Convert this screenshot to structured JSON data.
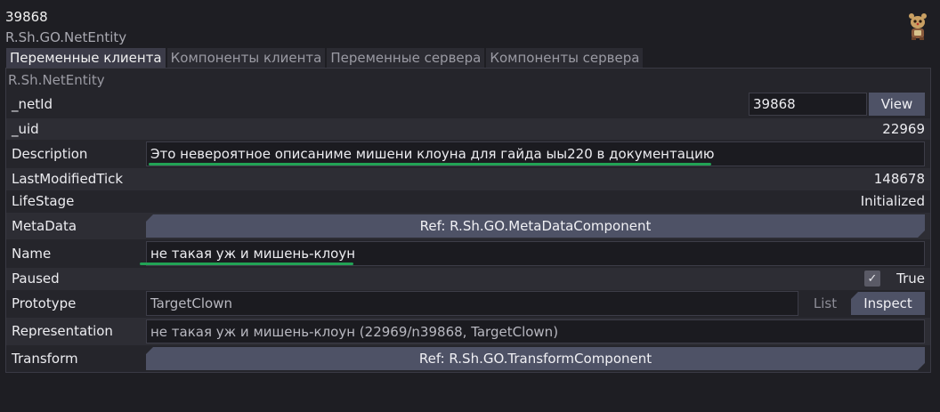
{
  "header": {
    "entity_id": "39868",
    "entity_type": "R.Sh.GO.NetEntity",
    "mascot_icon": "clown-mascot-icon"
  },
  "tabs": [
    {
      "label": "Переменные клиента",
      "active": true
    },
    {
      "label": "Компоненты клиента",
      "active": false
    },
    {
      "label": "Переменные сервера",
      "active": false
    },
    {
      "label": "Компоненты сервера",
      "active": false
    }
  ],
  "panel": {
    "subheader": "R.Sh.NetEntity",
    "rows": {
      "net_id": {
        "label": "_netId",
        "value": "39868",
        "button": "View"
      },
      "uid": {
        "label": "_uid",
        "value": "22969"
      },
      "description": {
        "label": "Description",
        "value": "Это невероятное описаниме мишени клоуна для гайда ыы220 в документацию"
      },
      "last_modified_tick": {
        "label": "LastModifiedTick",
        "value": "148678"
      },
      "life_stage": {
        "label": "LifeStage",
        "value": "Initialized"
      },
      "meta_data": {
        "label": "MetaData",
        "value": "Ref: R.Sh.GO.MetaDataComponent"
      },
      "name": {
        "label": "Name",
        "value": "не такая уж и мишень-клоун"
      },
      "paused": {
        "label": "Paused",
        "value": "True",
        "checked": true,
        "check_mark": "✓"
      },
      "prototype": {
        "label": "Prototype",
        "value": "TargetClown",
        "list_button": "List",
        "inspect_button": "Inspect"
      },
      "representation": {
        "label": "Representation",
        "value": "не такая уж и мишень-клоун (22969/n39868, TargetClown)"
      },
      "transform": {
        "label": "Transform",
        "value": "Ref: R.Sh.GO.TransformComponent"
      }
    }
  },
  "colors": {
    "background": "#1e1e23",
    "panel": "#25252b",
    "button": "#4e5266",
    "highlight_underline": "#22a355"
  }
}
